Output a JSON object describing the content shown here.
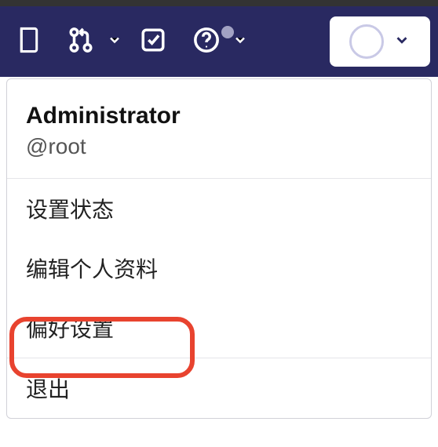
{
  "topbar": {
    "icons": {
      "issues": "issues-icon",
      "mr": "merge-request-icon",
      "todo": "todo-icon",
      "help": "help-icon"
    }
  },
  "user": {
    "display_name": "Administrator",
    "handle": "@root"
  },
  "menu": {
    "set_status": "设置状态",
    "edit_profile": "编辑个人资料",
    "preferences": "偏好设置",
    "sign_out": "退出"
  },
  "highlight_target": "preferences"
}
